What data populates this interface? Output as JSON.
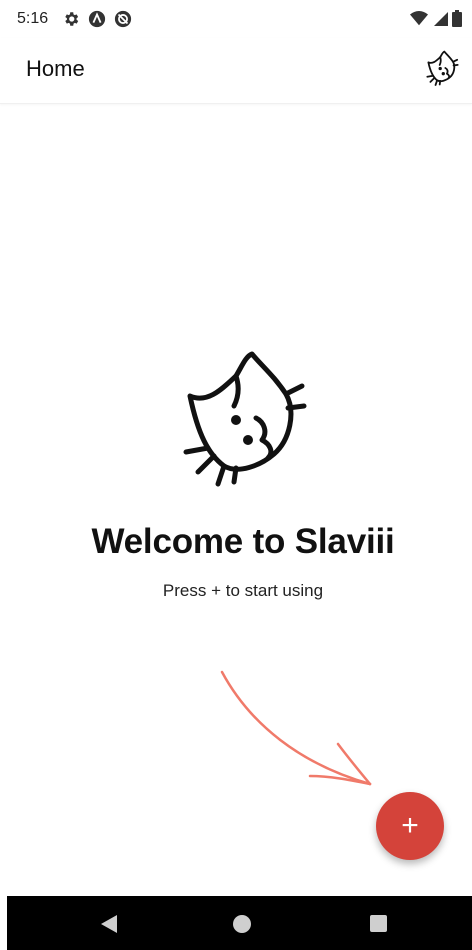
{
  "status_bar": {
    "time": "5:16",
    "icons_left": [
      "settings-icon",
      "arc-icon",
      "sync-icon"
    ],
    "icons_right": [
      "wifi-icon",
      "signal-icon",
      "battery-icon"
    ]
  },
  "app_bar": {
    "title": "Home",
    "logo_icon": "cat-logo-icon"
  },
  "welcome": {
    "title": "Welcome to Slaviii",
    "subtitle": "Press + to start using",
    "logo_icon": "cat-logo-icon"
  },
  "fab": {
    "label": "+",
    "color": "#d4433a",
    "icon": "plus-icon"
  },
  "hint": {
    "arrow_color": "#f07a6a",
    "icon": "arrow-icon"
  },
  "nav_bar": {
    "buttons": [
      "back-icon",
      "home-icon",
      "recents-icon"
    ]
  }
}
